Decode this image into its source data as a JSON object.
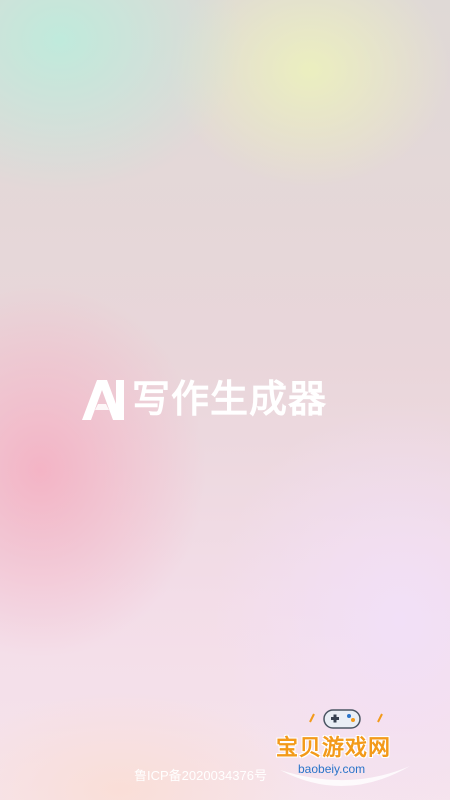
{
  "splash": {
    "logo_letters": "AI",
    "app_title": "写作生成器",
    "icp_text": "鲁ICP备2020034376号"
  },
  "watermark": {
    "title": "宝贝游戏网",
    "url": "baobeiy.com"
  },
  "colors": {
    "text": "#ffffff",
    "watermark_orange": "#f39a1a",
    "watermark_blue": "#2a74c9"
  },
  "icons": {
    "logo_mark": "ai-logo-icon",
    "watermark_mark": "gamepad-icon"
  }
}
